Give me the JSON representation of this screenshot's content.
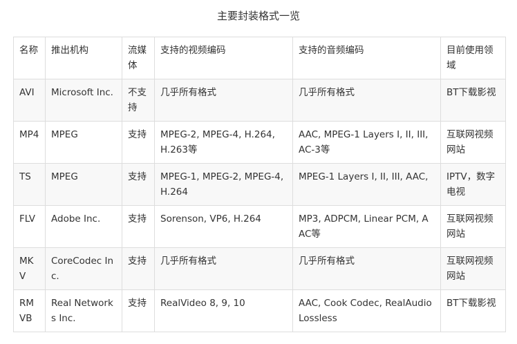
{
  "caption": "主要封装格式一览",
  "table": {
    "headers": [
      "名称",
      "推出机构",
      "流媒体",
      "支持的视频编码",
      "支持的音频编码",
      "目前使用领域"
    ],
    "rows": [
      [
        "AVI",
        "Microsoft Inc.",
        "不支持",
        "几乎所有格式",
        "几乎所有格式",
        "BT下载影视"
      ],
      [
        "MP4",
        "MPEG",
        "支持",
        "MPEG-2, MPEG-4, H.264, H.263等",
        "AAC, MPEG-1 Layers I, II, III, AC-3等",
        "互联网视频网站"
      ],
      [
        "TS",
        "MPEG",
        "支持",
        "MPEG-1, MPEG-2, MPEG-4, H.264",
        "MPEG-1 Layers I, II, III, AAC,",
        "IPTV，数字电视"
      ],
      [
        "FLV",
        "Adobe Inc.",
        "支持",
        "Sorenson, VP6, H.264",
        "MP3, ADPCM, Linear PCM, AAC等",
        "互联网视频网站"
      ],
      [
        "MKV",
        "CoreCodec Inc.",
        "支持",
        "几乎所有格式",
        "几乎所有格式",
        "互联网视频网站"
      ],
      [
        "RMVB",
        "Real Networks Inc.",
        "支持",
        "RealVideo 8, 9, 10",
        "AAC, Cook Codec, RealAudio Lossless",
        "BT下载影视"
      ]
    ]
  }
}
